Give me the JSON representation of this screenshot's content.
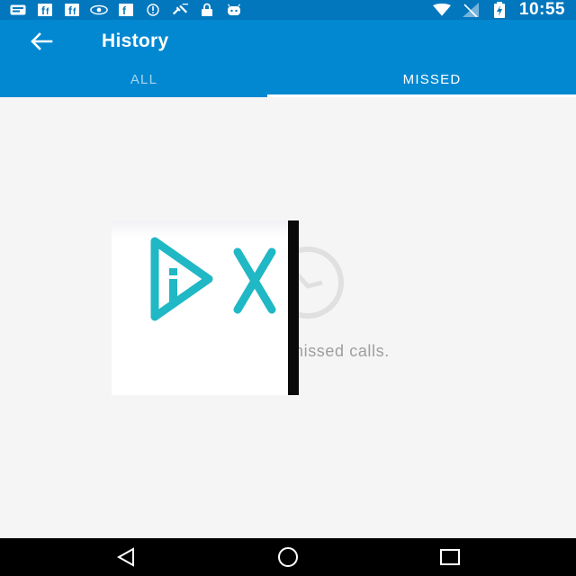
{
  "status_bar": {
    "time": "10:55",
    "left_icons": [
      "message-icon",
      "facebook-icon",
      "facebook-icon",
      "eye-icon",
      "facebook-icon",
      "info-icon",
      "satellite-icon",
      "lock-icon",
      "android-icon"
    ],
    "right_icons": [
      "wifi-icon",
      "no-signal-icon",
      "battery-charging-icon"
    ]
  },
  "app_bar": {
    "title": "History",
    "tabs": [
      {
        "label": "ALL",
        "selected": false
      },
      {
        "label": "MISSED",
        "selected": true
      }
    ]
  },
  "content": {
    "empty_message": "missed calls.",
    "empty_icon": "clock-icon"
  },
  "overlay": {
    "logo_icon": "dx-logo-icon",
    "logo_color": "#1fb8c4"
  },
  "nav_bar": {
    "buttons": [
      "back-triangle-icon",
      "home-circle-icon",
      "recents-square-icon"
    ]
  },
  "colors": {
    "status_bar": "#0277bd",
    "app_bar": "#0288d1",
    "background": "#f5f5f5",
    "empty_text": "#9e9e9e"
  }
}
